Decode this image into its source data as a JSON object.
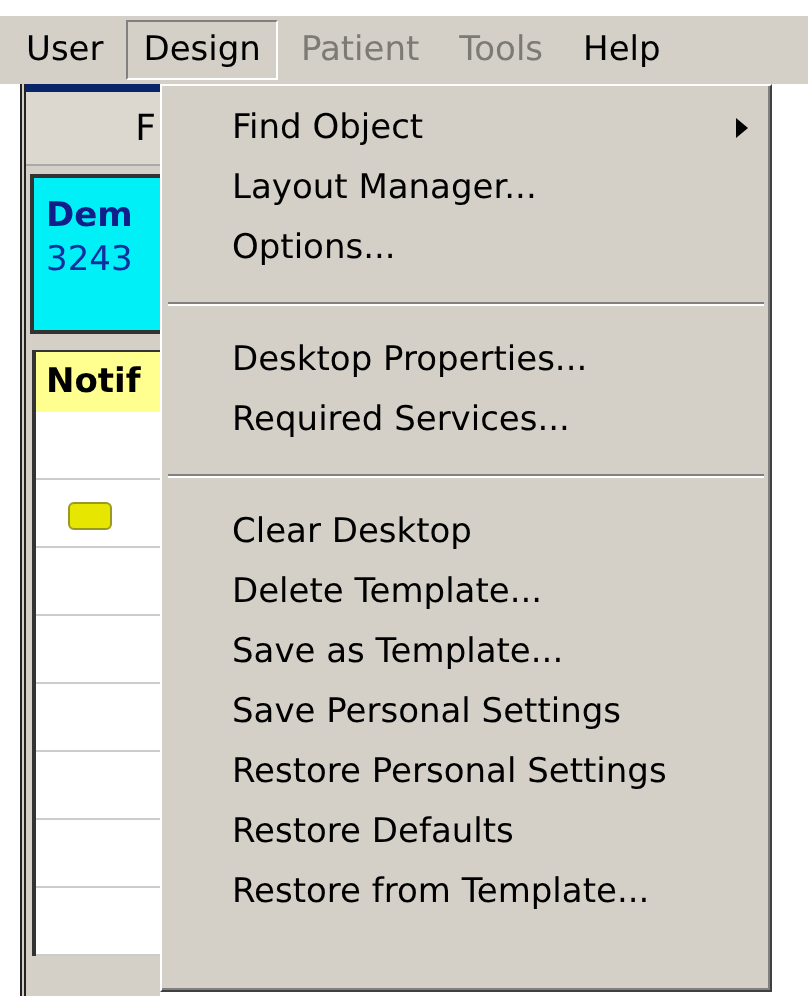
{
  "menu_bar": [
    {
      "label": "User",
      "selected": false,
      "disabled": false
    },
    {
      "label": "Design",
      "selected": true,
      "disabled": false
    },
    {
      "label": "Patient",
      "selected": false,
      "disabled": true
    },
    {
      "label": "Tools",
      "selected": false,
      "disabled": true
    },
    {
      "label": "Help",
      "selected": false,
      "disabled": false
    }
  ],
  "background_panel": {
    "tab_label": "F",
    "patient_name": "Dem",
    "patient_id": "3243",
    "column_header": "Notif",
    "rows": [
      {
        "kind": "empty"
      },
      {
        "kind": "note"
      },
      {
        "kind": "empty"
      },
      {
        "kind": "empty"
      },
      {
        "kind": "empty"
      },
      {
        "kind": "empty"
      },
      {
        "kind": "empty"
      },
      {
        "kind": "empty"
      }
    ]
  },
  "dropdown_menu": [
    {
      "kind": "item",
      "label": "Find Object",
      "submenu": true
    },
    {
      "kind": "item",
      "label": "Layout Manager...",
      "submenu": false
    },
    {
      "kind": "item",
      "label": "Options...",
      "submenu": false
    },
    {
      "kind": "separator"
    },
    {
      "kind": "item",
      "label": "Desktop Properties...",
      "submenu": false
    },
    {
      "kind": "item",
      "label": "Required Services...",
      "submenu": false
    },
    {
      "kind": "separator"
    },
    {
      "kind": "item",
      "label": "Clear Desktop",
      "submenu": false
    },
    {
      "kind": "item",
      "label": "Delete Template...",
      "submenu": false
    },
    {
      "kind": "item",
      "label": "Save as Template...",
      "submenu": false
    },
    {
      "kind": "item",
      "label": "Save Personal Settings",
      "submenu": false
    },
    {
      "kind": "item",
      "label": "Restore Personal Settings",
      "submenu": false
    },
    {
      "kind": "item",
      "label": "Restore Defaults",
      "submenu": false
    },
    {
      "kind": "item",
      "label": "Restore from Template...",
      "submenu": false
    }
  ]
}
